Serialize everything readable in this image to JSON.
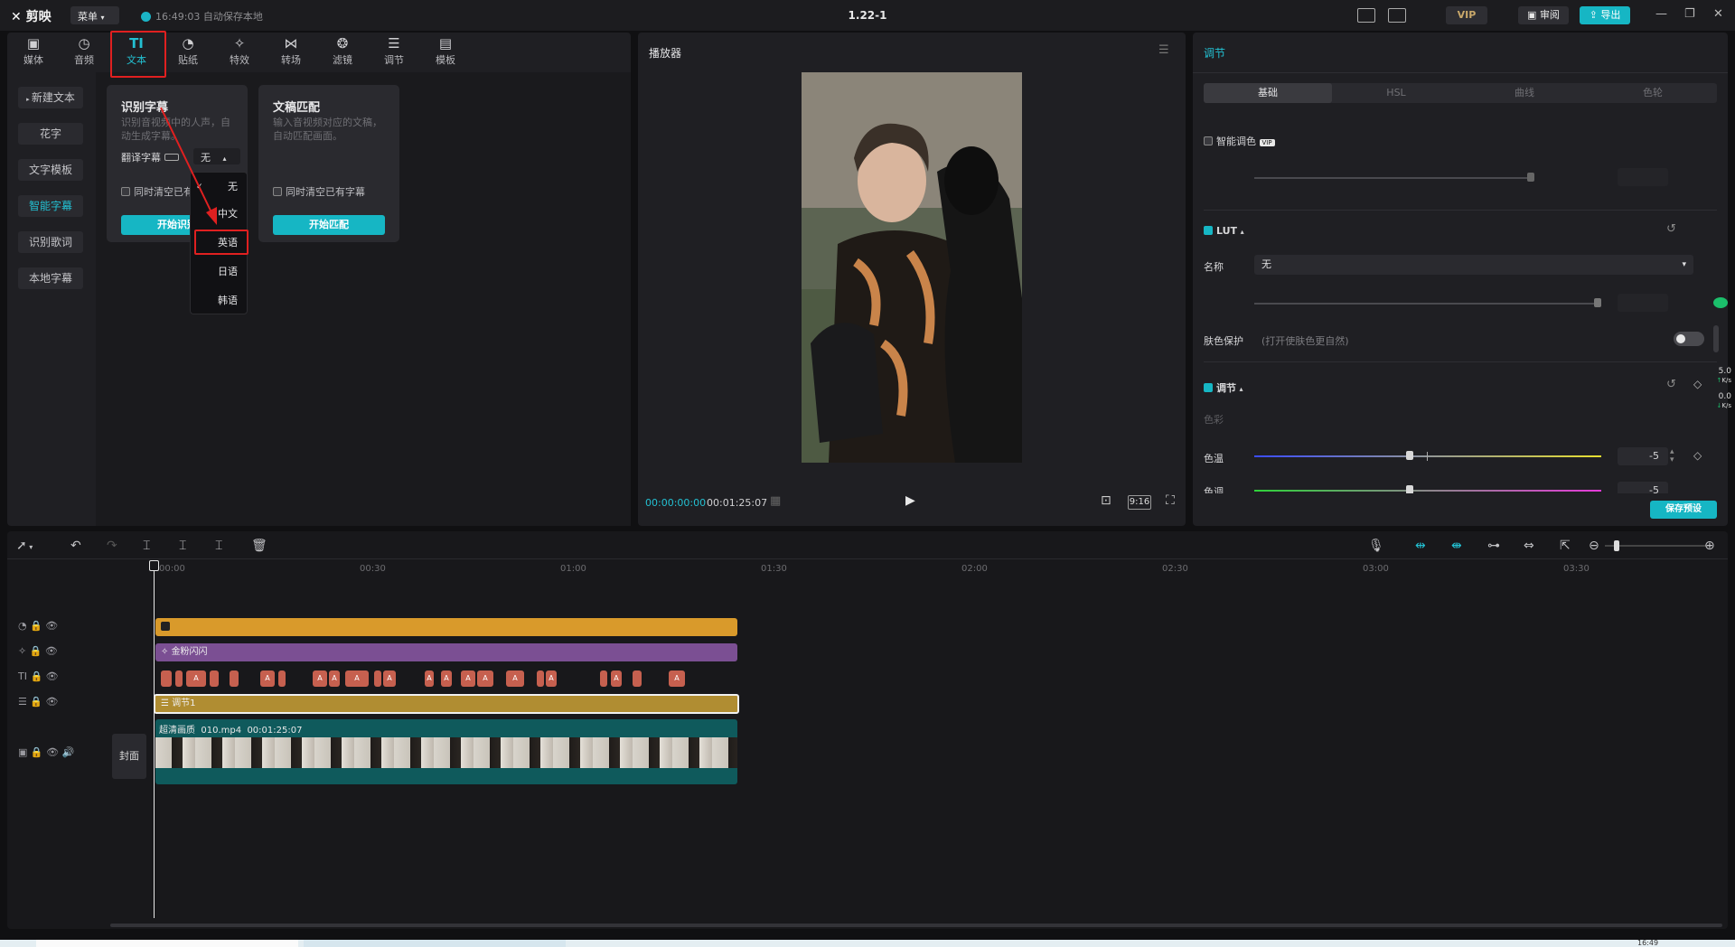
{
  "app": {
    "logo": "剪映",
    "menu_label": "菜单",
    "autosave": "16:49:03 自动保存本地",
    "project_title": "1.22-1",
    "vip": "VIP",
    "review": "审阅",
    "export": "导出"
  },
  "toolbar": {
    "tabs": [
      {
        "label": "媒体",
        "icon": "media-icon"
      },
      {
        "label": "音频",
        "icon": "audio-icon"
      },
      {
        "label": "文本",
        "icon": "text-icon"
      },
      {
        "label": "贴纸",
        "icon": "sticker-icon"
      },
      {
        "label": "特效",
        "icon": "effects-icon"
      },
      {
        "label": "转场",
        "icon": "transition-icon"
      },
      {
        "label": "滤镜",
        "icon": "filter-icon"
      },
      {
        "label": "调节",
        "icon": "adjust-icon"
      },
      {
        "label": "模板",
        "icon": "template-icon"
      }
    ],
    "active_tab": "文本"
  },
  "sidebar": {
    "items": [
      "新建文本",
      "花字",
      "文字模板",
      "智能字幕",
      "识别歌词",
      "本地字幕"
    ],
    "active": "智能字幕"
  },
  "recognize_card": {
    "title": "识别字幕",
    "desc": "识别音视频中的人声，自动生成字幕。",
    "translate_label": "翻译字幕",
    "translate_value": "无",
    "clear_label": "同时清空已有",
    "button": "开始识别"
  },
  "match_card": {
    "title": "文稿匹配",
    "desc": "输入音视频对应的文稿，自动匹配画面。",
    "clear_label": "同时清空已有字幕",
    "button": "开始匹配"
  },
  "language_dropdown": {
    "options": [
      "无",
      "中文",
      "英语",
      "日语",
      "韩语"
    ],
    "checked": "无",
    "highlighted": "英语"
  },
  "player": {
    "title": "播放器",
    "current_time": "00:00:00:00",
    "total_time": "00:01:25:07",
    "ratio": "9:16"
  },
  "adjust": {
    "title": "调节",
    "tabs": [
      "基础",
      "HSL",
      "曲线",
      "色轮"
    ],
    "active_tab": "基础",
    "smart_color": "智能调色",
    "lut_label": "LUT",
    "name_label": "名称",
    "name_value": "无",
    "skin_label": "肤色保护",
    "skin_hint": "(打开使肤色更自然)",
    "adjust_section": "调节",
    "color_label": "色彩",
    "temp_label": "色温",
    "temp_value": "-5",
    "tone_label": "色调",
    "tone_value": "-5",
    "save_preset": "保存预设"
  },
  "net_monitor": {
    "up": "5.0",
    "up_unit": "K/s",
    "down": "0.0",
    "down_unit": "K/s"
  },
  "timeline": {
    "ruler": [
      "00:00",
      "00:30",
      "01:00",
      "01:30",
      "02:00",
      "02:30",
      "03:00",
      "03:30"
    ],
    "effect_clip": "金粉闪闪",
    "adjust_clip": "调节1",
    "video_badge": "超清画质",
    "video_name": "010.mp4",
    "video_duration": "00:01:25:07",
    "cover_label": "封面"
  },
  "taskbar": {
    "clock": "16:49"
  },
  "colors": {
    "accent": "#16b6c4",
    "highlight": "#e02020",
    "sticker_clip": "#d99a2b",
    "effect_clip": "#7b4f93",
    "adjust_clip": "#b08d32",
    "video_clip": "#0f5a5c",
    "subtitle_clip": "#c6604f"
  }
}
